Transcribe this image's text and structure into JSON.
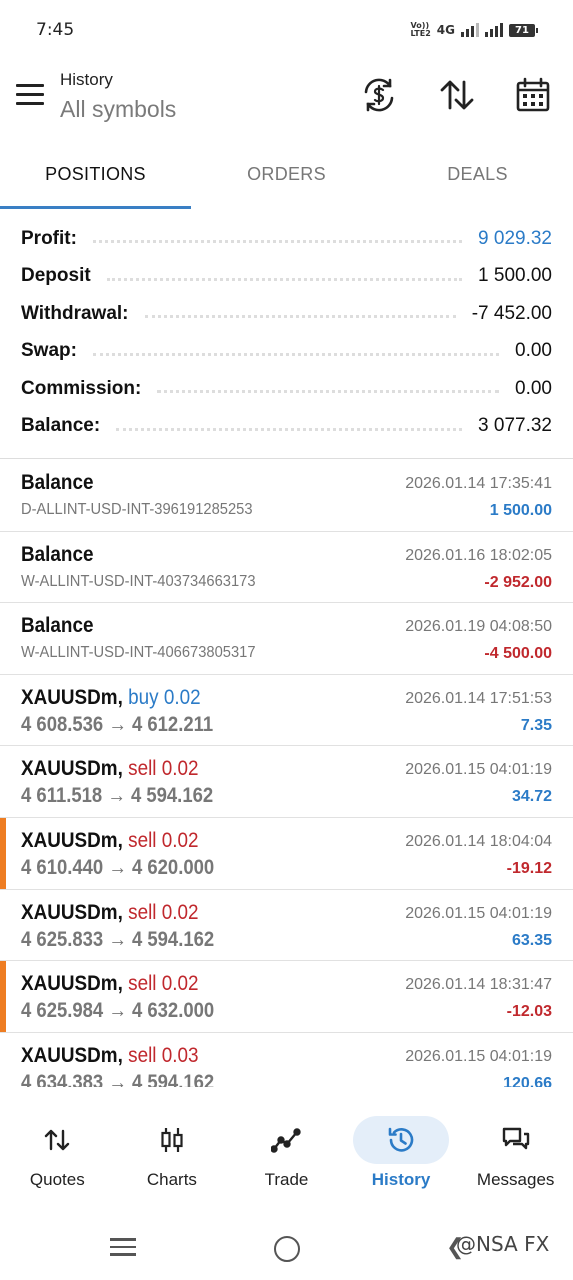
{
  "status_bar": {
    "time": "7:45",
    "volte": "Vo)) LTE2",
    "network": "4G",
    "battery": "71"
  },
  "header": {
    "title": "History",
    "subtitle": "All symbols"
  },
  "tabs": [
    {
      "label": "POSITIONS",
      "active": true
    },
    {
      "label": "ORDERS",
      "active": false
    },
    {
      "label": "DEALS",
      "active": false
    }
  ],
  "summary": [
    {
      "label": "Profit:",
      "value": "9 029.32"
    },
    {
      "label": "Deposit",
      "value": "1 500.00"
    },
    {
      "label": "Withdrawal:",
      "value": "-7 452.00"
    },
    {
      "label": "Swap:",
      "value": "0.00"
    },
    {
      "label": "Commission:",
      "value": "0.00"
    },
    {
      "label": "Balance:",
      "value": "3 077.32"
    }
  ],
  "balance_ops": [
    {
      "title": "Balance",
      "id": "D-ALLINT-USD-INT-396191285253",
      "date": "2026.01.14 17:35:41",
      "amount": "1 500.00"
    },
    {
      "title": "Balance",
      "id": "W-ALLINT-USD-INT-403734663173",
      "date": "2026.01.16 18:02:05",
      "amount": "-2 952.00"
    },
    {
      "title": "Balance",
      "id": "W-ALLINT-USD-INT-406673805317",
      "date": "2026.01.19 04:08:50",
      "amount": "-4 500.00"
    }
  ],
  "trades": [
    {
      "symbol": "XAUUSDm,",
      "side": "buy 0.02",
      "prices": "4 608.536 → 4 612.211",
      "date": "2026.01.14 17:51:53",
      "profit": "7.35"
    },
    {
      "symbol": "XAUUSDm,",
      "side": "sell 0.02",
      "prices": "4 611.518 → 4 594.162",
      "date": "2026.01.15 04:01:19",
      "profit": "34.72"
    },
    {
      "symbol": "XAUUSDm,",
      "side": "sell 0.02",
      "prices": "4 610.440 → 4 620.000",
      "date": "2026.01.14 18:04:04",
      "profit": "-19.12"
    },
    {
      "symbol": "XAUUSDm,",
      "side": "sell 0.02",
      "prices": "4 625.833 → 4 594.162",
      "date": "2026.01.15 04:01:19",
      "profit": "63.35"
    },
    {
      "symbol": "XAUUSDm,",
      "side": "sell 0.02",
      "prices": "4 625.984 → 4 632.000",
      "date": "2026.01.14 18:31:47",
      "profit": "-12.03"
    },
    {
      "symbol": "XAUUSDm,",
      "side": "sell 0.03",
      "prices": "4 634.383 → 4 594.162",
      "date": "2026.01.15 04:01:19",
      "profit": "120.66"
    }
  ],
  "bottom_nav": [
    {
      "label": "Quotes",
      "icon": "quotes-arrows-icon"
    },
    {
      "label": "Charts",
      "icon": "candles-icon"
    },
    {
      "label": "Trade",
      "icon": "trade-line-icon"
    },
    {
      "label": "History",
      "icon": "history-clock-icon",
      "active": true
    },
    {
      "label": "Messages",
      "icon": "chat-bubbles-icon"
    }
  ],
  "watermark": "@NSA FX",
  "colors": {
    "accent_blue": "#2b7bc7",
    "loss_red": "#c0282d",
    "stop_marker": "#ee7d22"
  }
}
